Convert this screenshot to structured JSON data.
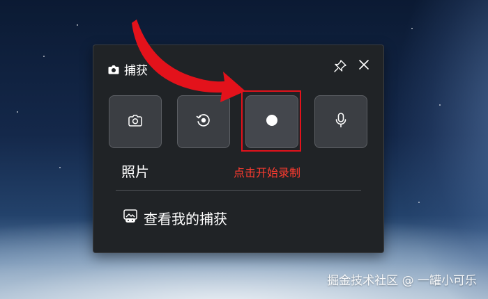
{
  "panel": {
    "title": "捕获",
    "title_icon": "camera-icon",
    "pin_icon": "pin-icon",
    "close_icon": "close-icon"
  },
  "tiles": [
    {
      "name": "screenshot",
      "icon": "camera-icon"
    },
    {
      "name": "recent-recording",
      "icon": "rewind-icon"
    },
    {
      "name": "start-recording",
      "icon": "record-dot-icon",
      "selected": true
    },
    {
      "name": "microphone",
      "icon": "microphone-icon"
    }
  ],
  "caption": "照片",
  "annotation": {
    "hint": "点击开始录制",
    "color": "#ff3b2f"
  },
  "view_captures": {
    "label": "查看我的捕获",
    "icon": "gallery-icon"
  },
  "watermark": "掘金技术社区 @ 一罐小可乐"
}
